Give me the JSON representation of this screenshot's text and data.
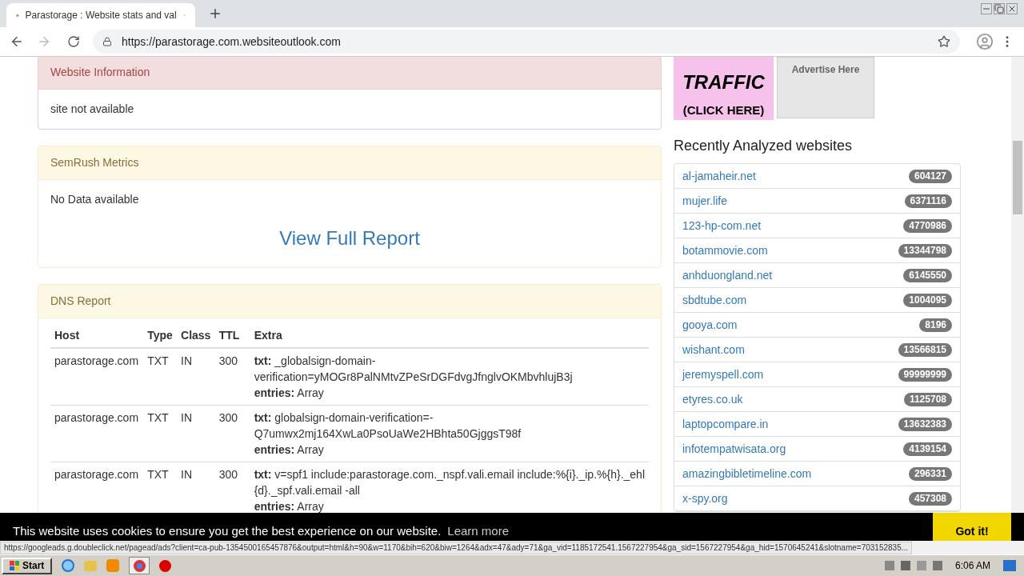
{
  "browser": {
    "tab_title": "Parastorage : Website stats and val",
    "url": "https://parastorage.com.websiteoutlook.com"
  },
  "panels": [
    {
      "kind": "danger",
      "title": "Website Information",
      "text": "site not available"
    },
    {
      "kind": "warning",
      "title": "SemRush Metrics",
      "text": "No Data available",
      "link": "View Full Report"
    },
    {
      "kind": "warning",
      "title": "DNS Report",
      "table": {
        "columns": [
          "Host",
          "Type",
          "Class",
          "TTL",
          "Extra"
        ],
        "rows": [
          {
            "host": "parastorage.com",
            "type": "TXT",
            "class": "IN",
            "ttl": "300",
            "extra": [
              "**txt:** _globalsign-domain-",
              "verification=yMOGr8PalNMtvZPeSrDGFdvgJfnglvOKMbvhlujB3j",
              "**entries:** Array"
            ]
          },
          {
            "host": "parastorage.com",
            "type": "TXT",
            "class": "IN",
            "ttl": "300",
            "extra": [
              "**txt:** globalsign-domain-verification=-",
              "Q7umwx2mj164XwLa0PsoUaWe2HBhta50GjggsT98f",
              "**entries:** Array"
            ]
          },
          {
            "host": "parastorage.com",
            "type": "TXT",
            "class": "IN",
            "ttl": "300",
            "extra": [
              "**txt:** v=spf1 include:parastorage.com._nspf.vali.email include:%{i}._ip.%{h}._ehl",
              "{d}._spf.vali.email -all",
              "**entries:** Array"
            ]
          }
        ]
      }
    }
  ],
  "sidebar": {
    "ad_banner": {
      "lines": [
        "TRAFFIC",
        "(CLICK HERE)"
      ]
    },
    "ad_placeholder": "Advertise Here",
    "heading": "Recently Analyzed websites",
    "items": [
      {
        "site": "al-jamaheir.net",
        "count": "604127"
      },
      {
        "site": "mujer.life",
        "count": "6371116"
      },
      {
        "site": "123-hp-com.net",
        "count": "4770986"
      },
      {
        "site": "botammovie.com",
        "count": "13344798"
      },
      {
        "site": "anhduongland.net",
        "count": "6145550"
      },
      {
        "site": "sbdtube.com",
        "count": "1004095"
      },
      {
        "site": "gooya.com",
        "count": "8196"
      },
      {
        "site": "wishant.com",
        "count": "13566815"
      },
      {
        "site": "jeremyspell.com",
        "count": "99999999"
      },
      {
        "site": "etyres.co.uk",
        "count": "1125708"
      },
      {
        "site": "laptopcompare.in",
        "count": "13632383"
      },
      {
        "site": "infotempatwisata.org",
        "count": "4139154"
      },
      {
        "site": "amazingbibletimeline.com",
        "count": "296331"
      },
      {
        "site": "x-spy.org",
        "count": "457308"
      }
    ]
  },
  "cookie_bar": {
    "text": "This website uses cookies to ensure you get the best experience on our website.",
    "link": "Learn more",
    "button": "Got it!"
  },
  "status_url": "https://googleads.g.doubleclick.net/pagead/ads?client=ca-pub-1354500165457876&output=html&h=90&w=1170&bih=620&biw=1264&adx=47&ady=71&ga_vid=1185172541.1567227954&ga_sid=1567227954&ga_hid=1570645241&slotname=703152835...",
  "taskbar": {
    "start": "Start",
    "time": "6:06 AM"
  }
}
